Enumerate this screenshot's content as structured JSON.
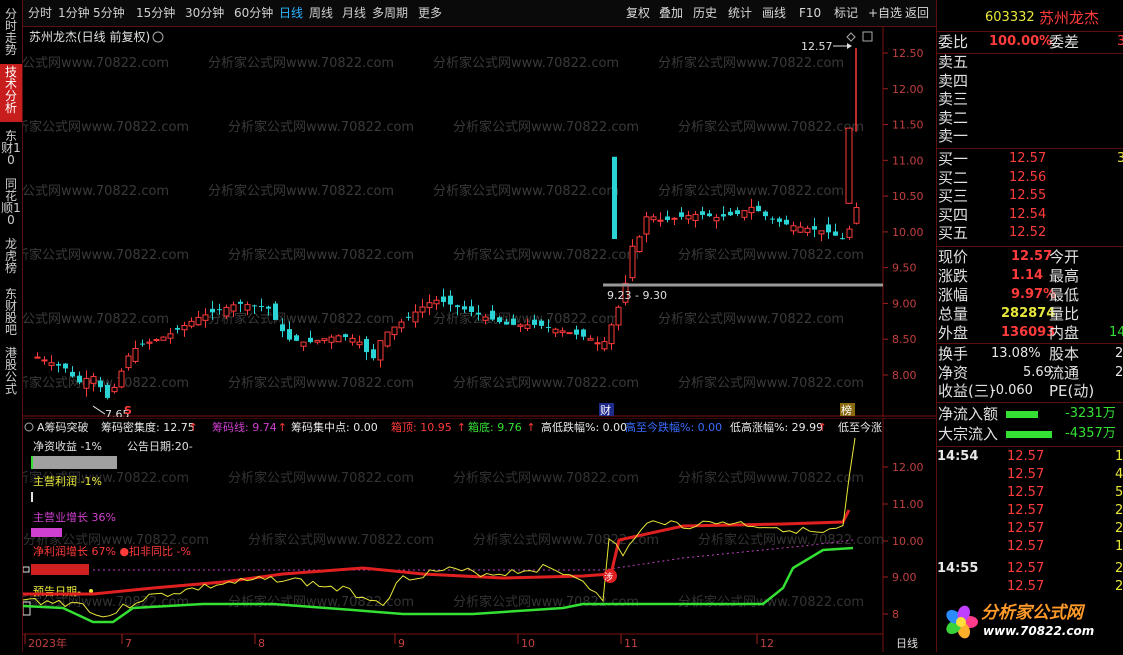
{
  "toolbar": {
    "periods": [
      "分时",
      "1分钟",
      "5分钟",
      "15分钟",
      "30分钟",
      "60分钟",
      "日线",
      "周线",
      "月线",
      "多周期",
      "更多"
    ],
    "active_period": "日线",
    "buttons": [
      "复权",
      "叠加",
      "历史",
      "统计",
      "画线",
      "F10",
      "标记",
      "+自选",
      "返回"
    ]
  },
  "side_tabs": [
    "分时走势",
    "技术分析",
    "东财10",
    "同花顺10",
    "龙虎榜",
    "东财股吧",
    "港股公式"
  ],
  "main_chart": {
    "title": "苏州龙杰(日线 前复权)",
    "y_ticks": [
      "12.50",
      "12.00",
      "11.50",
      "11.00",
      "10.50",
      "10.00",
      "9.50",
      "9.00",
      "8.50",
      "8.00"
    ],
    "high_label": "12.57",
    "low_label": "7.65",
    "range_label": "9.23 - 9.30",
    "markers": [
      "S",
      "财",
      "榜"
    ],
    "watermark": "分析家公式网www.70822.com"
  },
  "indicator_bar": {
    "name": "A筹码突破",
    "items": [
      {
        "label": "筹码密集度: 12.75",
        "color": "#e8e8e8"
      },
      {
        "label": "筹码线: 9.74",
        "color": "#d040d0"
      },
      {
        "label": "筹码集中点: 0.00",
        "color": "#e8e8e8"
      },
      {
        "label": "箱顶: 10.95",
        "color": "#ff3b3b"
      },
      {
        "label": "箱底: 9.76",
        "color": "#33e033"
      },
      {
        "label": "高低跌幅%: 0.00",
        "color": "#e8e8e8"
      },
      {
        "label": "高至今跌幅%: 0.00",
        "color": "#3a6cff"
      },
      {
        "label": "低高涨幅%: 29.99",
        "color": "#e8e8e8"
      },
      {
        "label": "低至今涨",
        "color": "#e8e8e8"
      }
    ]
  },
  "sub_chart": {
    "net_return": "净资收益 -1%",
    "announce": "公告日期:20-",
    "main_profit": "主营利润 -1%",
    "main_growth": "主营业增长 36%",
    "net_profit_growth": "净利润增长 67% ●扣非同比 -%",
    "preview": "预告日期-",
    "y_ticks": [
      "12.00",
      "11.00",
      "10.00",
      "9.00",
      "8"
    ],
    "x_labels": [
      "2023年",
      "7",
      "8",
      "9",
      "10",
      "11",
      "12"
    ],
    "badge": "涉",
    "corner_label": "日线"
  },
  "quote": {
    "code": "603332",
    "name": "苏州龙杰",
    "ratio_label": "委比",
    "ratio_value": "100.00%",
    "diff_label": "委差",
    "diff_value": "3",
    "sells": [
      {
        "label": "卖五",
        "price": ""
      },
      {
        "label": "卖四",
        "price": ""
      },
      {
        "label": "卖三",
        "price": ""
      },
      {
        "label": "卖二",
        "price": ""
      },
      {
        "label": "卖一",
        "price": ""
      }
    ],
    "buys": [
      {
        "label": "买一",
        "price": "12.57",
        "vol": "3"
      },
      {
        "label": "买二",
        "price": "12.56",
        "vol": ""
      },
      {
        "label": "买三",
        "price": "12.55",
        "vol": ""
      },
      {
        "label": "买四",
        "price": "12.54",
        "vol": ""
      },
      {
        "label": "买五",
        "price": "12.52",
        "vol": ""
      }
    ],
    "stats": [
      {
        "l1": "现价",
        "v1": "12.57",
        "c1": "red",
        "l2": "今开",
        "v2": ""
      },
      {
        "l1": "涨跌",
        "v1": "1.14",
        "c1": "red",
        "l2": "最高",
        "v2": ""
      },
      {
        "l1": "涨幅",
        "v1": "9.97%",
        "c1": "red",
        "l2": "最低",
        "v2": ""
      },
      {
        "l1": "总量",
        "v1": "282874",
        "c1": "yellow",
        "l2": "量比",
        "v2": ""
      },
      {
        "l1": "外盘",
        "v1": "136093",
        "c1": "red",
        "l2": "内盘",
        "v2": "14"
      }
    ],
    "stats2": [
      {
        "l1": "换手",
        "v1": "13.08%",
        "c1": "white",
        "l2": "股本",
        "v2": "2."
      },
      {
        "l1": "净资",
        "v1": "5.69",
        "c1": "white",
        "l2": "流通",
        "v2": "2."
      },
      {
        "l1": "收益(三)",
        "v1": "-0.060",
        "c1": "white",
        "l2": "PE(动)",
        "v2": ""
      }
    ],
    "net_inflow_label": "净流入额",
    "net_inflow_value": "-3231万",
    "block_label": "大宗流入",
    "block_value": "-4357万",
    "ticks": [
      {
        "time": "14:54",
        "price": "12.57",
        "vol": "1"
      },
      {
        "time": "",
        "price": "12.57",
        "vol": "4"
      },
      {
        "time": "",
        "price": "12.57",
        "vol": "5"
      },
      {
        "time": "",
        "price": "12.57",
        "vol": "2"
      },
      {
        "time": "",
        "price": "12.57",
        "vol": "2"
      },
      {
        "time": "",
        "price": "12.57",
        "vol": "1"
      },
      {
        "time": "14:55",
        "price": "12.57",
        "vol": "2"
      },
      {
        "time": "",
        "price": "12.57",
        "vol": "2"
      }
    ],
    "logo_text": "分析家公式网",
    "logo_url": "www.70822.com"
  }
}
